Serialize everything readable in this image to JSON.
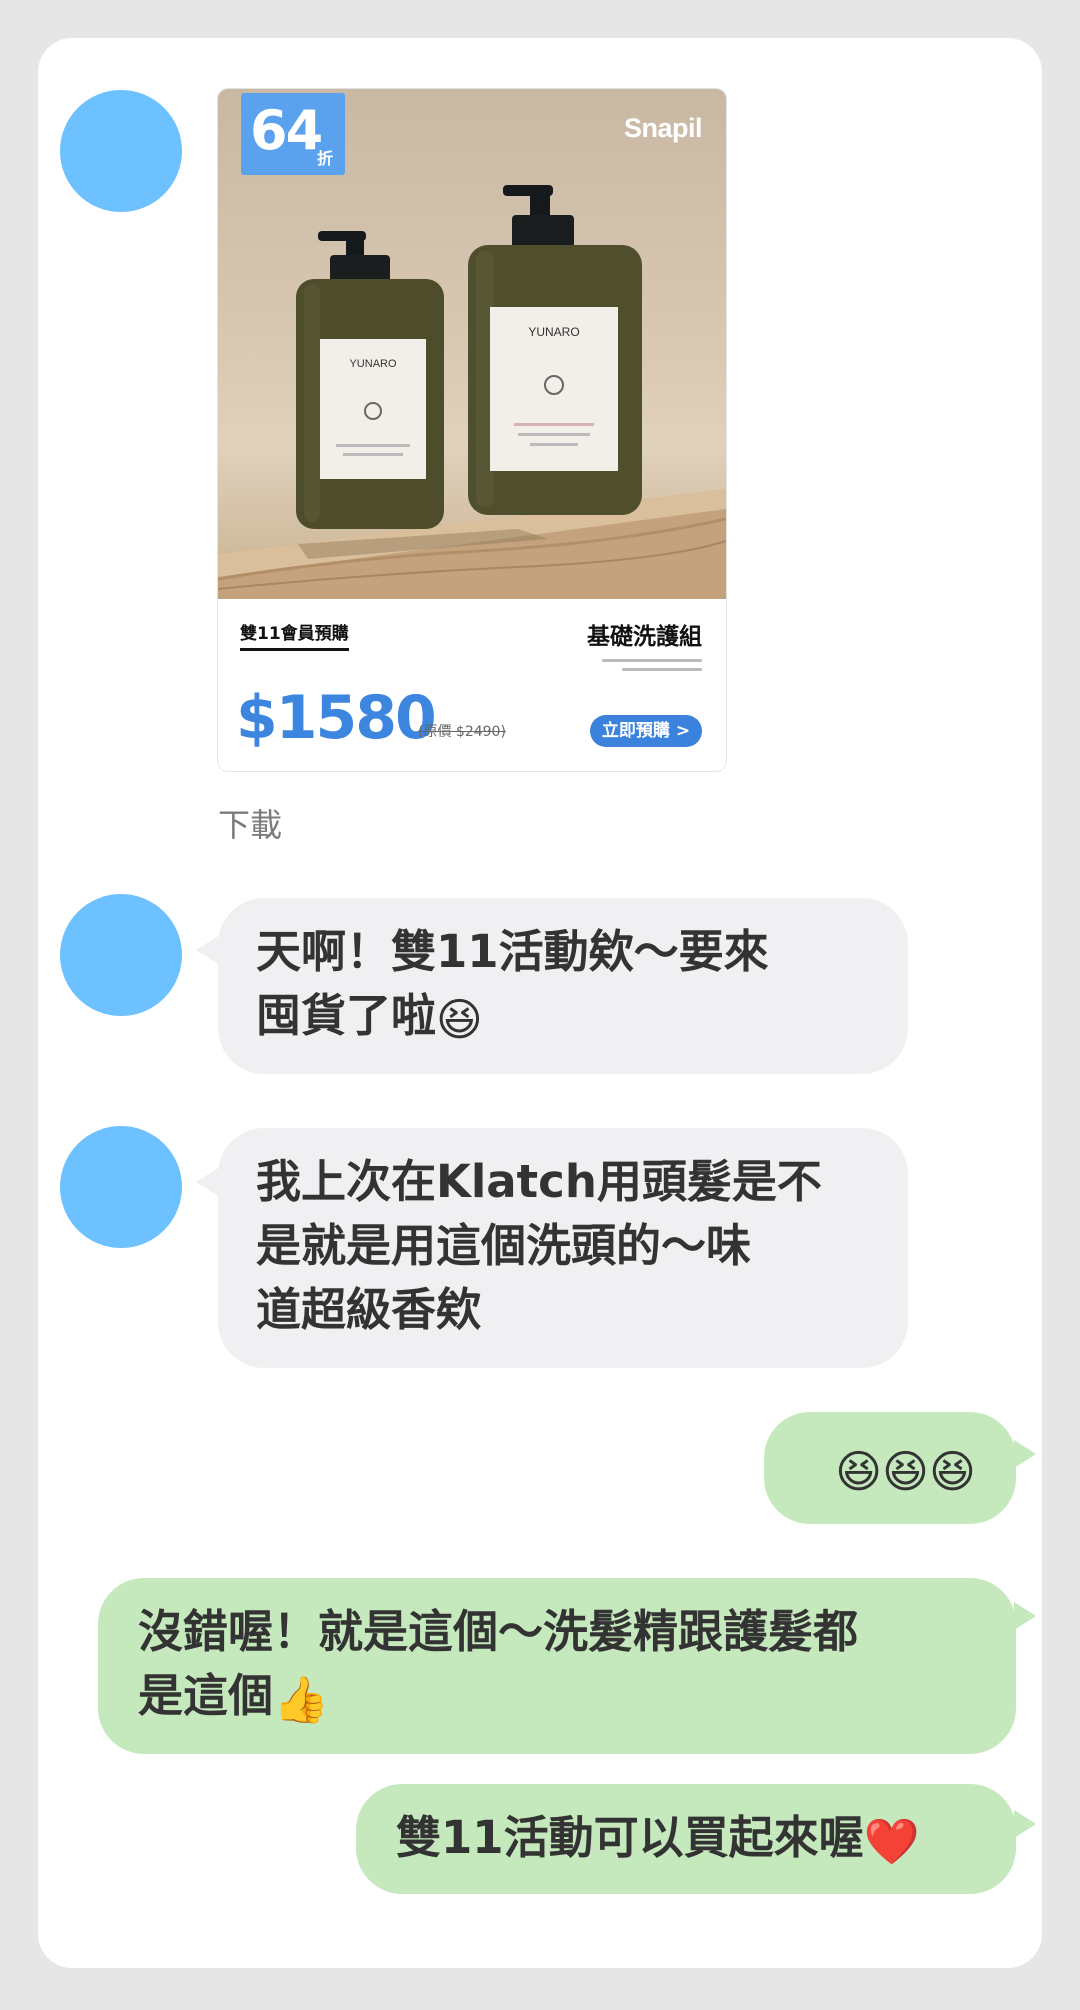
{
  "product_card": {
    "discount_number": "64",
    "discount_unit": "折",
    "brand": "Snapil",
    "bottle_label": "YUNARO",
    "promo_tag": "雙11會員預購",
    "product_name": "基礎洗護組",
    "price": "$1580",
    "original_price": "(原價 $2490)",
    "cta": "立即預購 >"
  },
  "download_label": "下載",
  "messages": [
    {
      "side": "in",
      "lines": [
        "天啊！雙11活動欸～要來",
        "囤貨了啦"
      ],
      "emoji": "😆"
    },
    {
      "side": "in",
      "lines": [
        "我上次在Klatch用頭髮是不",
        "是就是用這個洗頭的～味",
        "道超級香欸"
      ]
    },
    {
      "side": "out",
      "lines": [
        ""
      ],
      "emoji": "😆😆😆"
    },
    {
      "side": "out",
      "lines": [
        "沒錯喔！就是這個～洗髮精跟護髮都",
        "是這個"
      ],
      "emoji": "👍"
    },
    {
      "side": "out",
      "lines": [
        "雙11活動可以買起來喔"
      ],
      "emoji": "❤️"
    }
  ],
  "colors": {
    "avatar": "#6cc1fe",
    "incoming_bubble": "#f0f0f2",
    "outgoing_bubble": "#c5e8bd",
    "price_blue": "#3d86e0"
  }
}
